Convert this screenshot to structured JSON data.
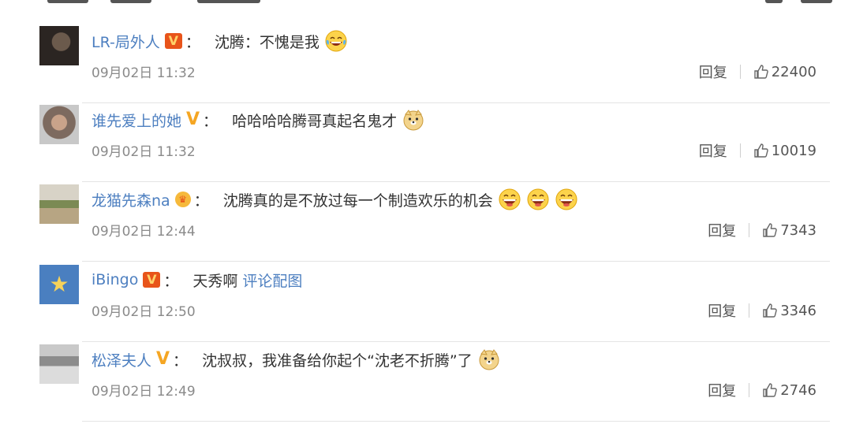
{
  "comments": [
    {
      "username": "LR-局外人",
      "badge": "vip",
      "badge_text": "V",
      "colon": "：",
      "text": "沈腾：不愧是我",
      "link": "",
      "emojis": [
        "laugh-cry"
      ],
      "timestamp": "09月02日 11:32",
      "reply_label": "回复",
      "likes": "22400"
    },
    {
      "username": "谁先爱上的她",
      "badge": "v",
      "badge_text": "V",
      "colon": "：",
      "text": "哈哈哈哈腾哥真起名鬼才",
      "link": "",
      "emojis": [
        "doge"
      ],
      "timestamp": "09月02日 11:32",
      "reply_label": "回复",
      "likes": "10019"
    },
    {
      "username": "龙猫先森na",
      "badge": "crown",
      "badge_text": "♛",
      "colon": "：",
      "text": "沈腾真的是不放过每一个制造欢乐的机会",
      "link": "",
      "emojis": [
        "grin",
        "grin",
        "grin"
      ],
      "timestamp": "09月02日 12:44",
      "reply_label": "回复",
      "likes": "7343"
    },
    {
      "username": "iBingo",
      "badge": "vip",
      "badge_text": "V",
      "colon": "：",
      "text": "天秀啊",
      "link": "评论配图",
      "emojis": [],
      "timestamp": "09月02日 12:50",
      "reply_label": "回复",
      "likes": "3346"
    },
    {
      "username": "松泽夫人",
      "badge": "v",
      "badge_text": "V",
      "colon": "：",
      "text": "沈叔叔，我准备给你起个“沈老不折腾”了",
      "link": "",
      "emojis": [
        "doge"
      ],
      "timestamp": "09月02日 12:49",
      "reply_label": "回复",
      "likes": "2746"
    }
  ],
  "icons": {
    "like": "thumb-up-icon",
    "vip_badge": "vip-badge-icon",
    "v_badge": "verified-v-icon",
    "crown_badge": "crown-badge-icon"
  },
  "colors": {
    "username": "#4d7fc0",
    "timestamp": "#8a8a8a",
    "vip_badge": "#e8541a",
    "v_badge": "#f5a623"
  }
}
